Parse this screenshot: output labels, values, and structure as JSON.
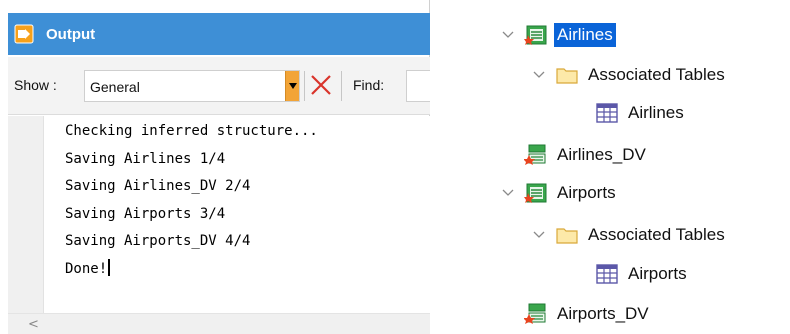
{
  "output": {
    "title": "Output",
    "show_label": "Show :",
    "show_value": "General",
    "find_label": "Find:",
    "find_value": "",
    "scroll_left_arrow": "<",
    "lines": [
      "Checking inferred structure...",
      "Saving Airlines 1/4",
      "Saving Airlines_DV 2/4",
      "Saving Airports 3/4",
      "Saving Airports_DV 4/4",
      "Done!"
    ]
  },
  "tree": {
    "nodes": [
      {
        "label": "Airlines",
        "icon": "transaction-icon",
        "selected": true
      },
      {
        "label": "Associated Tables",
        "icon": "folder-icon"
      },
      {
        "label": "Airlines",
        "icon": "table-icon"
      },
      {
        "label": "Airlines_DV",
        "icon": "data-view-icon"
      },
      {
        "label": "Airports",
        "icon": "transaction-icon"
      },
      {
        "label": "Associated Tables",
        "icon": "folder-icon"
      },
      {
        "label": "Airports",
        "icon": "table-icon"
      },
      {
        "label": "Airports_DV",
        "icon": "data-view-icon"
      }
    ]
  },
  "colors": {
    "header_blue": "#3e8fd6",
    "selection_blue": "#0a64d8",
    "dropdown_orange": "#f2a437",
    "clear_red": "#d9342b"
  }
}
